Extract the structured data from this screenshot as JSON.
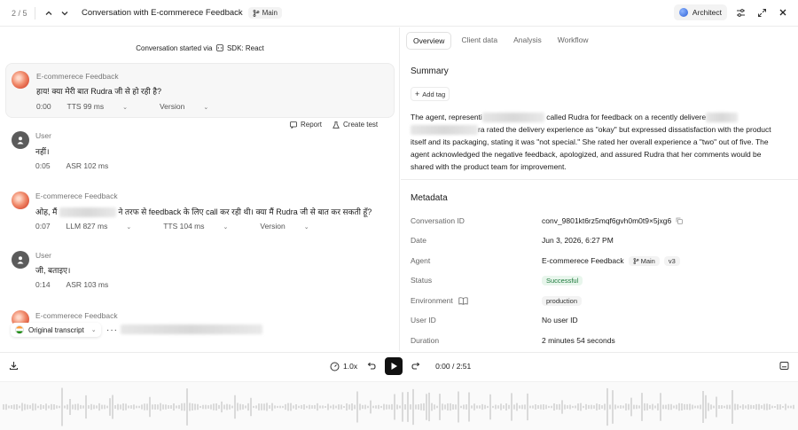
{
  "header": {
    "pager": "2 / 5",
    "title": "Conversation with E-commerece Feedback",
    "branch": "Main",
    "architect_label": "Architect"
  },
  "transcript": {
    "started_text": "Conversation started via",
    "started_source": "SDK: React",
    "messages": [
      {
        "sender": "E-commerece Feedback",
        "text": "हाय! क्या मेरी बात Rudra जी से हो रही है?",
        "time": "0:00",
        "metrics": [
          "TTS 99 ms",
          "Version"
        ]
      },
      {
        "sender": "User",
        "text": "नहीं।",
        "time": "0:05",
        "metrics": [
          "ASR 102 ms"
        ]
      },
      {
        "sender": "E-commerece Feedback",
        "text_before": "ओह, मैं",
        "text_after": "ने तरफ से feedback के लिए call कर रही थी। क्या मैं Rudra जी से बात कर सकती हूँ?",
        "time": "0:07",
        "metrics": [
          "LLM 827 ms",
          "TTS 104 ms",
          "Version"
        ]
      },
      {
        "sender": "User",
        "text": "जी, बताइए।",
        "time": "0:14",
        "metrics": [
          "ASR 103 ms"
        ]
      },
      {
        "sender": "E-commerece Feedback"
      }
    ],
    "actions": {
      "report": "Report",
      "create_test": "Create test"
    },
    "language_label": "Original transcript"
  },
  "panel": {
    "tabs": [
      "Overview",
      "Client data",
      "Analysis",
      "Workflow"
    ],
    "summary_title": "Summary",
    "add_tag": "Add tag",
    "summary_parts": {
      "p1": "The agent, representi",
      "p2": "called Rudra for feedback on a recently delivere",
      "p3": "ra rated the delivery experience as \"okay\" but expressed dissatisfaction with the product itself and its packaging, stating it was \"not special.\" She rated her overall experience a \"two\" out of five. The agent acknowledged the negative feedback, apologized, and assured Rudra that her comments would be shared with the product team for improvement."
    },
    "metadata_title": "Metadata",
    "metadata": {
      "conversation_id_label": "Conversation ID",
      "conversation_id": "conv_9801kt6rz5mqf6gvh0m0t9×5jxg6",
      "date_label": "Date",
      "date": "Jun 3, 2026, 6:27 PM",
      "agent_label": "Agent",
      "agent": "E-commerece Feedback",
      "agent_branch": "Main",
      "agent_version": "v3",
      "status_label": "Status",
      "status": "Successful",
      "environment_label": "Environment",
      "environment": "production",
      "user_id_label": "User ID",
      "user_id": "No user ID",
      "duration_label": "Duration",
      "duration": "2 minutes 54 seconds"
    }
  },
  "player": {
    "speed": "1.0x",
    "time": "0:00 / 2:51"
  }
}
